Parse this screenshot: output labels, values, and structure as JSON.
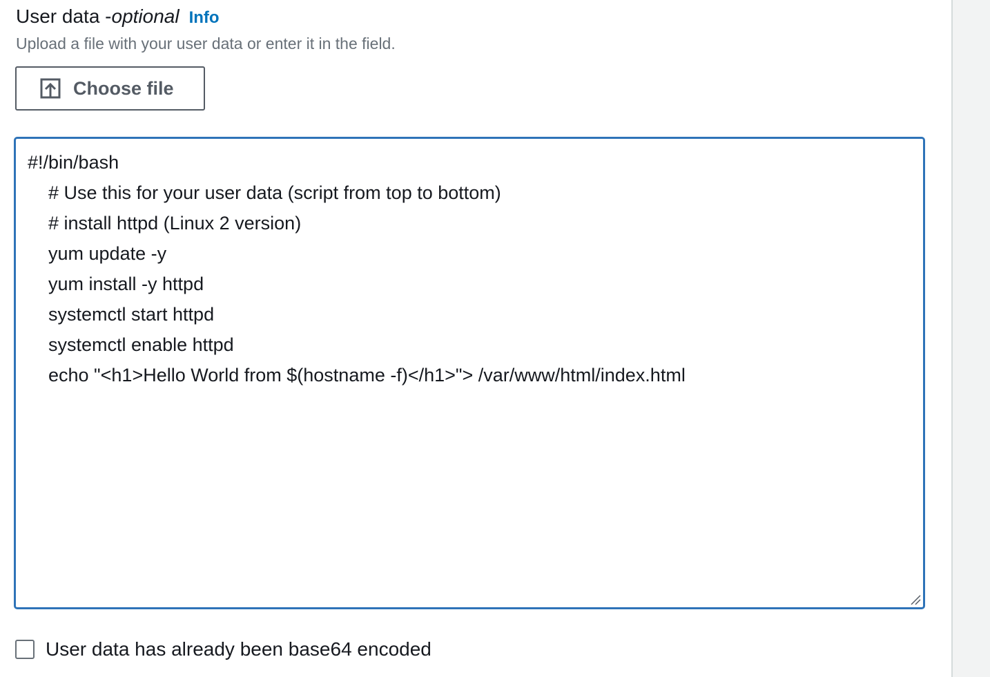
{
  "user_data": {
    "label": "User data - ",
    "optional": "optional",
    "info_link": "Info",
    "description": "Upload a file with your user data or enter it in the field.",
    "choose_file_button": "Choose file",
    "choose_file_icon": "upload-icon",
    "script_lines": [
      "#!/bin/bash",
      "    # Use this for your user data (script from top to bottom)",
      "    # install httpd (Linux 2 version)",
      "    yum update -y",
      "    yum install -y httpd",
      "    systemctl start httpd",
      "    systemctl enable httpd",
      "    echo \"<h1>Hello World from $(hostname -f)</h1>\"> /var/www/html/index.html"
    ],
    "base64_checkbox": {
      "label": "User data has already been base64 encoded",
      "checked": false
    }
  },
  "colors": {
    "accent": "#0073bb",
    "focus_border": "#2e73b8",
    "button_border": "#545b64",
    "description_text": "#687078",
    "side_panel": "#f2f3f3"
  }
}
